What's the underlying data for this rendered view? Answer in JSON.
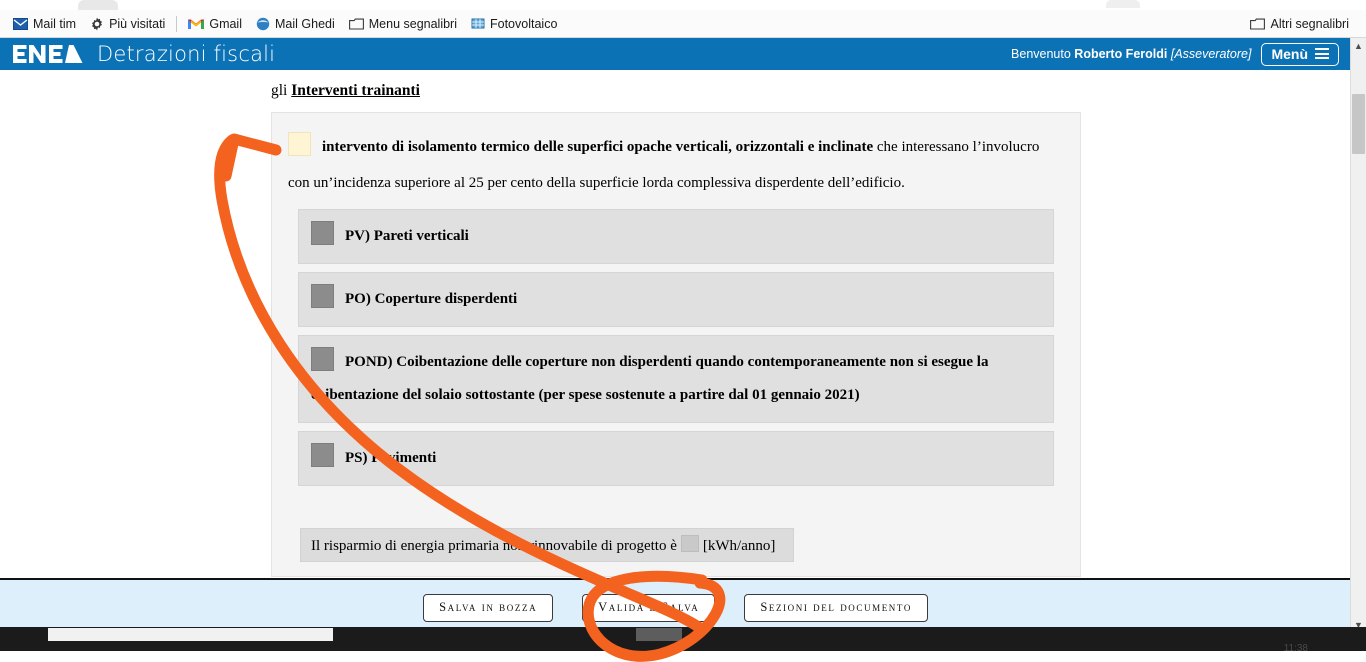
{
  "browser": {
    "bookmarks": [
      {
        "label": "Mail tim",
        "icon": "mail-icon"
      },
      {
        "label": "Più visitati",
        "icon": "gear-icon"
      },
      {
        "label": "Gmail",
        "icon": "gmail-icon"
      },
      {
        "label": "Mail Ghedi",
        "icon": "globe-icon"
      },
      {
        "label": "Menu segnalibri",
        "icon": "folder-icon"
      },
      {
        "label": "Fotovoltaico",
        "icon": "solar-panel-icon"
      }
    ],
    "other_bookmarks": {
      "label": "Altri segnalibri",
      "icon": "folder-icon"
    }
  },
  "header": {
    "logo_text": "ENEA",
    "title": "Detrazioni fiscali",
    "welcome_prefix": "Benvenuto",
    "user_name": "Roberto Feroldi",
    "user_role": "[Asseveratore]",
    "menu_label": "Menù",
    "brand_color": "#0c72b6"
  },
  "main": {
    "breadcrumb_prefix": "gli",
    "breadcrumb_link": "Interventi trainanti",
    "lead": {
      "checkbox_state": "checked-yellow",
      "bold_text": "intervento di isolamento termico delle superfici opache verticali, orizzontali e inclinate",
      "rest_text": "che interessano l’involucro con un’incidenza superiore al 25 per cento della superficie lorda complessiva disperdente dell’edificio."
    },
    "sub_items": [
      {
        "checkbox_state": "disabled-gray",
        "label": "PV) Pareti verticali"
      },
      {
        "checkbox_state": "disabled-gray",
        "label": "PO) Coperture disperdenti"
      },
      {
        "checkbox_state": "disabled-gray",
        "label": "POND) Coibentazione delle coperture non disperdenti quando contemporaneamente non si esegue la coibentazione del solaio sottostante (per spese sostenute a partire dal 01 gennaio 2021)"
      },
      {
        "checkbox_state": "disabled-gray",
        "label": "PS) Pavimenti"
      }
    ],
    "saving_row": {
      "text_before": "Il risparmio di energia primaria non rinnovabile di progetto è",
      "unit": "[kWh/anno]"
    }
  },
  "footer": {
    "buttons": [
      {
        "label": "Salva in bozza",
        "name": "save-draft-button"
      },
      {
        "label": "Valida e Salva",
        "name": "validate-save-button"
      },
      {
        "label": "Sezioni del documento",
        "name": "document-sections-button"
      }
    ]
  },
  "taskbar": {
    "clock": "11:38"
  },
  "annotations": {
    "arrow_color": "#f4621f",
    "arrow_target": "lead checkbox",
    "circle_target": "Valida e Salva"
  }
}
